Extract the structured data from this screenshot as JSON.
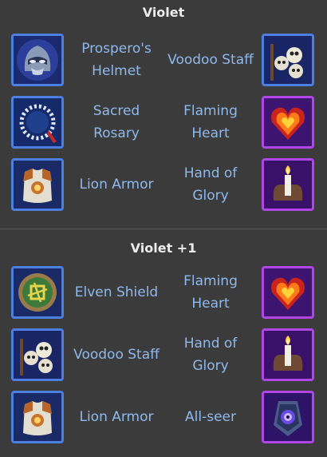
{
  "sections": [
    {
      "title": "Violet",
      "rows": [
        {
          "left": {
            "name": "Prospero's\nHelmet",
            "icon": "helmet-icon",
            "rarity": "blue"
          },
          "right": {
            "name": "Voodoo Staff",
            "icon": "voodoo-staff-icon",
            "rarity": "blue"
          }
        },
        {
          "left": {
            "name": "Sacred\nRosary",
            "icon": "rosary-icon",
            "rarity": "blue"
          },
          "right": {
            "name": "Flaming\nHeart",
            "icon": "flaming-heart-icon",
            "rarity": "purple"
          }
        },
        {
          "left": {
            "name": "Lion Armor",
            "icon": "lion-armor-icon",
            "rarity": "blue"
          },
          "right": {
            "name": "Hand of\nGlory",
            "icon": "hand-of-glory-icon",
            "rarity": "purple"
          }
        }
      ]
    },
    {
      "title": "Violet +1",
      "rows": [
        {
          "left": {
            "name": "Elven Shield",
            "icon": "elven-shield-icon",
            "rarity": "blue"
          },
          "right": {
            "name": "Flaming\nHeart",
            "icon": "flaming-heart-icon",
            "rarity": "purple"
          }
        },
        {
          "left": {
            "name": "Voodoo Staff",
            "icon": "voodoo-staff-icon",
            "rarity": "blue"
          },
          "right": {
            "name": "Hand of\nGlory",
            "icon": "hand-of-glory-icon",
            "rarity": "purple"
          }
        },
        {
          "left": {
            "name": "Lion Armor",
            "icon": "lion-armor-icon",
            "rarity": "blue"
          },
          "right": {
            "name": "All-seer",
            "icon": "all-seer-icon",
            "rarity": "purple"
          }
        }
      ]
    }
  ],
  "colors": {
    "background": "#3b3b3b",
    "title": "#ececec",
    "item_name": "#8fb9ec",
    "rarity_blue": "#4d7fe0",
    "rarity_purple": "#b046e6"
  }
}
